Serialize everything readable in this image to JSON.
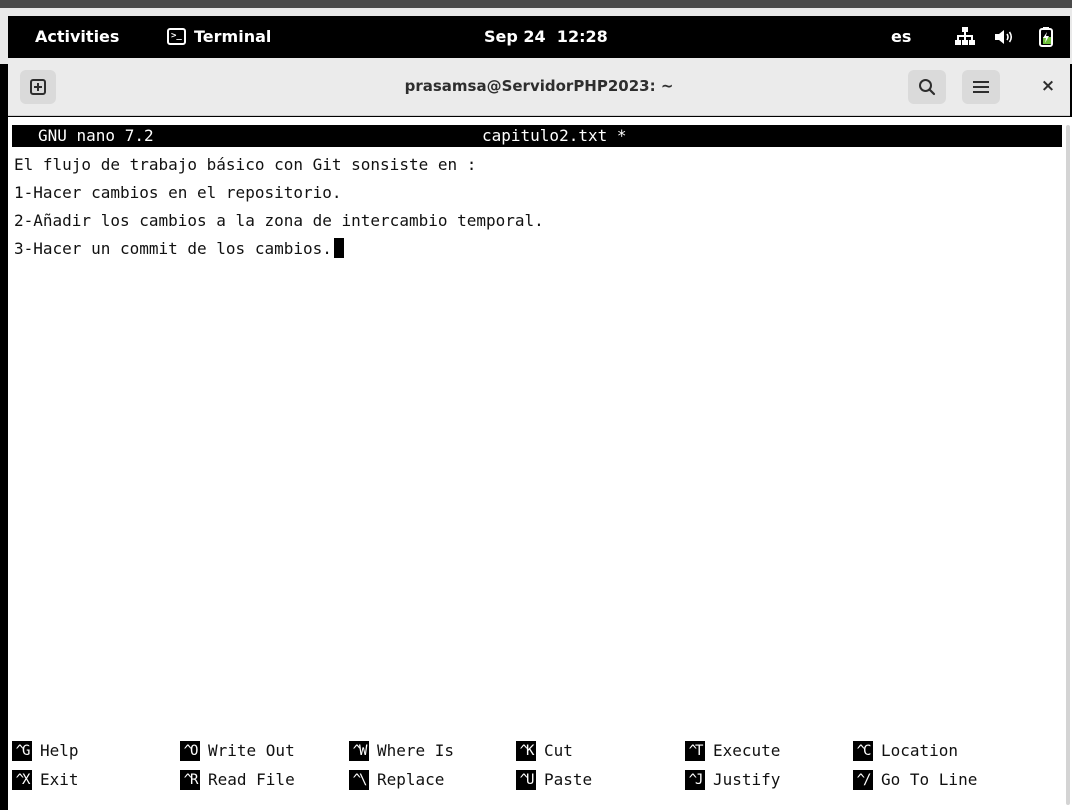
{
  "topbar": {
    "activities": "Activities",
    "app_name": "Terminal",
    "clock": "Sep 24  12:28",
    "language": "es",
    "network_icon": "network-wired-icon",
    "volume_icon": "speaker-volume-icon",
    "battery_icon": "battery-charging-icon"
  },
  "window": {
    "title": "prasamsa@ServidorPHP2023: ~",
    "new_tab_icon": "new-tab-plus-icon",
    "search_icon": "search-icon",
    "menu_icon": "hamburger-menu-icon",
    "close_label": "×"
  },
  "nano": {
    "version": "GNU nano 7.2",
    "filename": "capitulo2.txt *",
    "lines": [
      "El flujo de trabajo básico con Git sonsiste en :",
      "1-Hacer cambios en el repositorio.",
      "2-Añadir los cambios a la zona de intercambio temporal.",
      "3-Hacer un commit de los cambios."
    ],
    "shortcuts_row1": [
      {
        "key": "^G",
        "label": "Help"
      },
      {
        "key": "^O",
        "label": "Write Out"
      },
      {
        "key": "^W",
        "label": "Where Is"
      },
      {
        "key": "^K",
        "label": "Cut"
      },
      {
        "key": "^T",
        "label": "Execute"
      },
      {
        "key": "^C",
        "label": "Location"
      }
    ],
    "shortcuts_row2": [
      {
        "key": "^X",
        "label": "Exit"
      },
      {
        "key": "^R",
        "label": "Read File"
      },
      {
        "key": "^\\",
        "label": "Replace"
      },
      {
        "key": "^U",
        "label": "Paste"
      },
      {
        "key": "^J",
        "label": "Justify"
      },
      {
        "key": "^/",
        "label": "Go To Line"
      }
    ]
  }
}
